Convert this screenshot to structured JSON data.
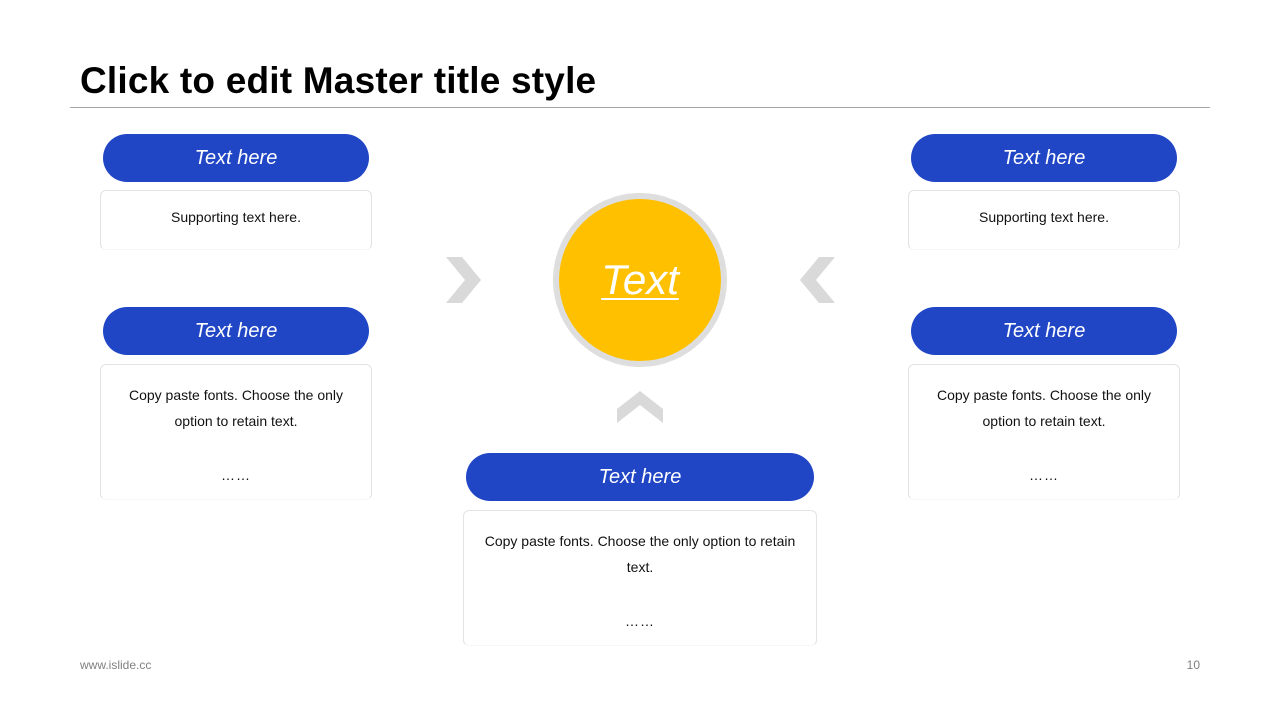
{
  "slide": {
    "title": "Click to edit Master title style",
    "footer_url": "www.islide.cc",
    "page_number": "10"
  },
  "center": {
    "label": "Text",
    "circle_color": "#ffc000",
    "ring_color": "#dedede"
  },
  "colors": {
    "pill": "#2045c5",
    "chevron": "#d9d9d9"
  },
  "boxes": {
    "top_left": {
      "heading": "Text here",
      "lines": [
        "Supporting text here."
      ]
    },
    "mid_left": {
      "heading": "Text here",
      "lines": [
        "Copy paste fonts. Choose the only",
        "option to retain text."
      ],
      "more": "……"
    },
    "top_right": {
      "heading": "Text here",
      "lines": [
        "Supporting text here."
      ]
    },
    "mid_right": {
      "heading": "Text here",
      "lines": [
        "Copy paste fonts. Choose the only",
        "option to retain text."
      ],
      "more": "……"
    },
    "bottom": {
      "heading": "Text here",
      "lines": [
        "Copy paste fonts. Choose the only option to retain",
        "text."
      ],
      "more": "……"
    }
  },
  "icons": {
    "left": "chevron-right-icon",
    "right": "chevron-left-icon",
    "bottom": "chevron-up-icon"
  }
}
